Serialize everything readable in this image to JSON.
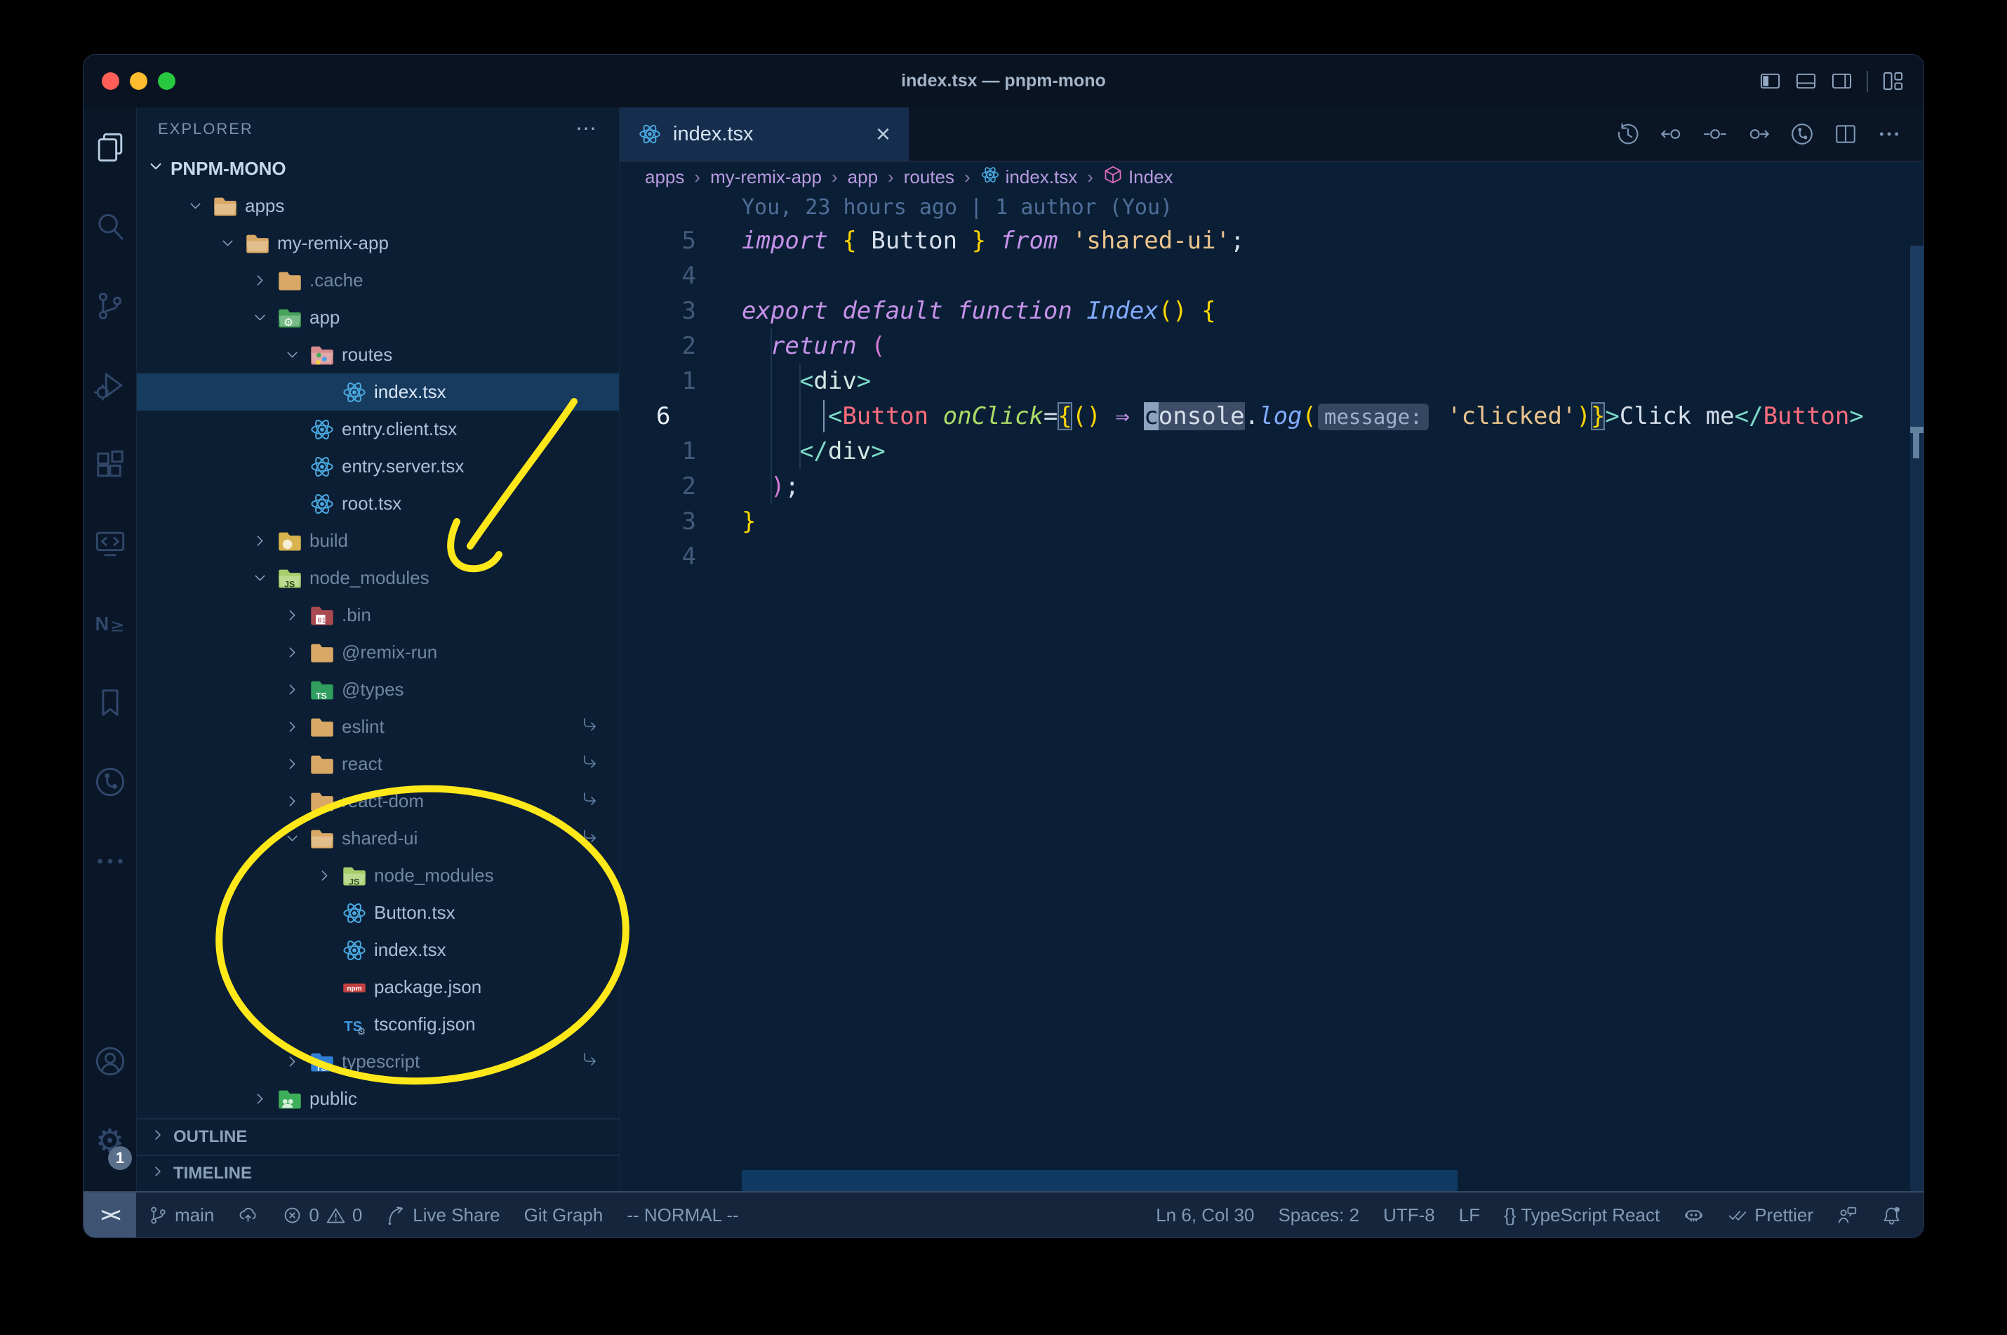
{
  "window": {
    "title": "index.tsx — pnpm-mono",
    "traffic_lights": [
      "close",
      "minimize",
      "zoom"
    ],
    "layout_icons": [
      "layout-sidebar-left",
      "layout-panel",
      "layout-sidebar-right",
      "|",
      "layout-grid"
    ]
  },
  "activity_bar": {
    "top": [
      {
        "name": "explorer",
        "icon": "files",
        "active": true
      },
      {
        "name": "search",
        "icon": "search"
      },
      {
        "name": "source-control",
        "icon": "scm"
      },
      {
        "name": "run-debug",
        "icon": "debug"
      },
      {
        "name": "extensions",
        "icon": "ext"
      },
      {
        "name": "remote-explorer",
        "icon": "remote"
      },
      {
        "name": "nx-console",
        "icon": "nx"
      },
      {
        "name": "bookmarks",
        "icon": "bookmark"
      },
      {
        "name": "gitlens",
        "icon": "gitlens"
      },
      {
        "name": "more-views",
        "icon": "more"
      }
    ],
    "bottom": [
      {
        "name": "accounts",
        "icon": "account"
      },
      {
        "name": "settings",
        "icon": "gear",
        "badge": "1"
      }
    ]
  },
  "sidebar": {
    "header": "EXPLORER",
    "more_label": "⋯",
    "section": "PNPM-MONO",
    "tree": [
      {
        "name": "apps",
        "icon": "folder-open",
        "depth": 1,
        "chev": "v"
      },
      {
        "name": "my-remix-app",
        "icon": "folder-open",
        "depth": 2,
        "chev": "v"
      },
      {
        "name": ".cache",
        "icon": "folder",
        "depth": 3,
        "chev": ">",
        "dim": true
      },
      {
        "name": "app",
        "icon": "folder-app",
        "depth": 3,
        "chev": "v"
      },
      {
        "name": "routes",
        "icon": "folder-routes",
        "depth": 4,
        "chev": "v"
      },
      {
        "name": "index.tsx",
        "icon": "react",
        "depth": 5,
        "selected": true
      },
      {
        "name": "entry.client.tsx",
        "icon": "react",
        "depth": 4
      },
      {
        "name": "entry.server.tsx",
        "icon": "react",
        "depth": 4
      },
      {
        "name": "root.tsx",
        "icon": "react",
        "depth": 4
      },
      {
        "name": "build",
        "icon": "folder-dist",
        "depth": 3,
        "chev": ">",
        "dim": true
      },
      {
        "name": "node_modules",
        "icon": "folder-js",
        "depth": 3,
        "chev": "v",
        "dim": true
      },
      {
        "name": ".bin",
        "icon": "folder-bin",
        "depth": 4,
        "chev": ">",
        "dim": true
      },
      {
        "name": "@remix-run",
        "icon": "folder",
        "depth": 4,
        "chev": ">",
        "dim": true
      },
      {
        "name": "@types",
        "icon": "folder-ts-green",
        "depth": 4,
        "chev": ">",
        "dim": true
      },
      {
        "name": "eslint",
        "icon": "folder",
        "depth": 4,
        "chev": ">",
        "dim": true,
        "symlink": true
      },
      {
        "name": "react",
        "icon": "folder",
        "depth": 4,
        "chev": ">",
        "dim": true,
        "symlink": true
      },
      {
        "name": "react-dom",
        "icon": "folder",
        "depth": 4,
        "chev": ">",
        "dim": true,
        "symlink": true
      },
      {
        "name": "shared-ui",
        "icon": "folder-open",
        "depth": 4,
        "chev": "v",
        "dim": true,
        "symlink": true
      },
      {
        "name": "node_modules",
        "icon": "folder-js",
        "depth": 5,
        "chev": ">",
        "dim": true
      },
      {
        "name": "Button.tsx",
        "icon": "react",
        "depth": 5
      },
      {
        "name": "index.tsx",
        "icon": "react",
        "depth": 5
      },
      {
        "name": "package.json",
        "icon": "npm",
        "depth": 5
      },
      {
        "name": "tsconfig.json",
        "icon": "ts-config",
        "depth": 5
      },
      {
        "name": "typescript",
        "icon": "folder-ts-blue",
        "depth": 4,
        "chev": ">",
        "dim": true,
        "symlink": true
      },
      {
        "name": "public",
        "icon": "folder-public",
        "depth": 3,
        "chev": ">"
      }
    ],
    "panels": [
      "OUTLINE",
      "TIMELINE"
    ]
  },
  "editor": {
    "tab": {
      "label": "index.tsx",
      "icon": "react",
      "close": "×"
    },
    "toolbar_icons": [
      {
        "name": "timeline-history",
        "icon": "history"
      },
      {
        "name": "previous-change",
        "icon": "prev-change"
      },
      {
        "name": "current-change",
        "icon": "change"
      },
      {
        "name": "next-change",
        "icon": "next-change"
      },
      {
        "name": "gitlens-graph",
        "icon": "gitlens"
      },
      {
        "name": "split-editor",
        "icon": "split"
      },
      {
        "name": "more-actions",
        "icon": "more"
      }
    ],
    "breadcrumbs": [
      {
        "label": "apps"
      },
      {
        "label": "my-remix-app"
      },
      {
        "label": "app"
      },
      {
        "label": "routes"
      },
      {
        "label": "index.tsx",
        "icon": "react"
      },
      {
        "label": "Index",
        "icon": "symbol-class"
      }
    ],
    "breadcrumb_separator": "›",
    "blame": "You, 23 hours ago | 1 author (You)",
    "code_lines": [
      {
        "n": "5",
        "tok": [
          [
            "import",
            "k"
          ],
          [
            " "
          ],
          [
            "{",
            "y"
          ],
          [
            " Button ",
            "w"
          ],
          [
            "}",
            "y"
          ],
          [
            " "
          ],
          [
            "from",
            "k"
          ],
          [
            " "
          ],
          [
            "'shared-ui'",
            "s"
          ],
          [
            ";",
            "w"
          ]
        ]
      },
      {
        "n": "4",
        "tok": []
      },
      {
        "n": "3",
        "tok": [
          [
            "export",
            "k"
          ],
          [
            " "
          ],
          [
            "default",
            "k"
          ],
          [
            " "
          ],
          [
            "function",
            "k"
          ],
          [
            " "
          ],
          [
            "Index",
            "fn"
          ],
          [
            "()",
            "y"
          ],
          [
            " "
          ],
          [
            "{",
            "y"
          ]
        ]
      },
      {
        "n": "2",
        "tok": [
          [
            "  "
          ],
          [
            "return",
            "k"
          ],
          [
            " "
          ],
          [
            "(",
            "pk"
          ]
        ]
      },
      {
        "n": "1",
        "tok": [
          [
            "    "
          ],
          [
            "<",
            "t"
          ],
          [
            "div",
            "tag"
          ],
          [
            ">",
            "t"
          ]
        ]
      },
      {
        "n": "6",
        "cur": true,
        "tok": [
          [
            "      "
          ],
          [
            "<",
            "t"
          ],
          [
            "Button",
            "cmp"
          ],
          [
            " "
          ],
          [
            "onClick",
            "at"
          ],
          [
            "=",
            "w"
          ],
          [
            "{",
            "y box"
          ],
          [
            "()",
            "y"
          ],
          [
            " "
          ],
          [
            "⇒",
            "ar"
          ],
          [
            " "
          ],
          [
            "c",
            "cursor"
          ],
          [
            "onsole",
            "hl"
          ],
          [
            ".",
            "w"
          ],
          [
            "log",
            "fn"
          ],
          [
            "(",
            "y"
          ],
          [
            "message:",
            "inlay"
          ],
          [
            " "
          ],
          [
            "'clicked'",
            "s"
          ],
          [
            ")",
            "y"
          ],
          [
            "}",
            "y box"
          ],
          [
            ">",
            "t"
          ],
          [
            "Click me",
            "w"
          ],
          [
            "</",
            "t"
          ],
          [
            "Button",
            "cmp"
          ],
          [
            ">",
            "t"
          ]
        ]
      },
      {
        "n": "1",
        "tok": [
          [
            "    "
          ],
          [
            "</",
            "t"
          ],
          [
            "div",
            "tag"
          ],
          [
            ">",
            "t"
          ]
        ]
      },
      {
        "n": "2",
        "tok": [
          [
            "  "
          ],
          [
            ")",
            "pk"
          ],
          [
            ";",
            "w"
          ]
        ]
      },
      {
        "n": "3",
        "tok": [
          [
            "}",
            "y"
          ]
        ]
      },
      {
        "n": "4",
        "tok": []
      }
    ]
  },
  "status_bar": {
    "remote_label": "><",
    "left": [
      {
        "name": "git-branch",
        "parts": [
          {
            "i": "branch"
          },
          {
            "t": "main"
          }
        ]
      },
      {
        "name": "sync-changes",
        "parts": [
          {
            "i": "cloud-up"
          }
        ]
      },
      {
        "name": "problems",
        "parts": [
          {
            "i": "error"
          },
          {
            "t": "0"
          },
          {
            "i": "warn"
          },
          {
            "t": "0"
          }
        ]
      },
      {
        "name": "live-share",
        "parts": [
          {
            "i": "share"
          },
          {
            "t": "Live Share"
          }
        ]
      },
      {
        "name": "git-graph",
        "parts": [
          {
            "t": "Git Graph"
          }
        ]
      },
      {
        "name": "vim-mode",
        "parts": [
          {
            "t": "-- NORMAL --"
          }
        ]
      }
    ],
    "right": [
      {
        "name": "cursor-position",
        "parts": [
          {
            "t": "Ln 6, Col 30"
          }
        ]
      },
      {
        "name": "indentation",
        "parts": [
          {
            "t": "Spaces: 2"
          }
        ]
      },
      {
        "name": "encoding",
        "parts": [
          {
            "t": "UTF-8"
          }
        ]
      },
      {
        "name": "eol",
        "parts": [
          {
            "t": "LF"
          }
        ]
      },
      {
        "name": "language-mode",
        "parts": [
          {
            "t": "{} TypeScript React"
          }
        ]
      },
      {
        "name": "copilot",
        "parts": [
          {
            "i": "copilot"
          }
        ]
      },
      {
        "name": "formatter-prettier",
        "parts": [
          {
            "i": "checks"
          },
          {
            "t": "Prettier"
          }
        ]
      },
      {
        "name": "feedback",
        "parts": [
          {
            "i": "feedback"
          }
        ]
      },
      {
        "name": "notifications",
        "parts": [
          {
            "i": "bell"
          }
        ]
      }
    ]
  },
  "colors": {
    "annotation_yellow": "#ffe81a",
    "selection_row": "#173a5f",
    "traffic_red": "#ff5f57",
    "traffic_yellow": "#febc2e",
    "traffic_green": "#28c840",
    "editor_bg": "#0a1f35"
  }
}
